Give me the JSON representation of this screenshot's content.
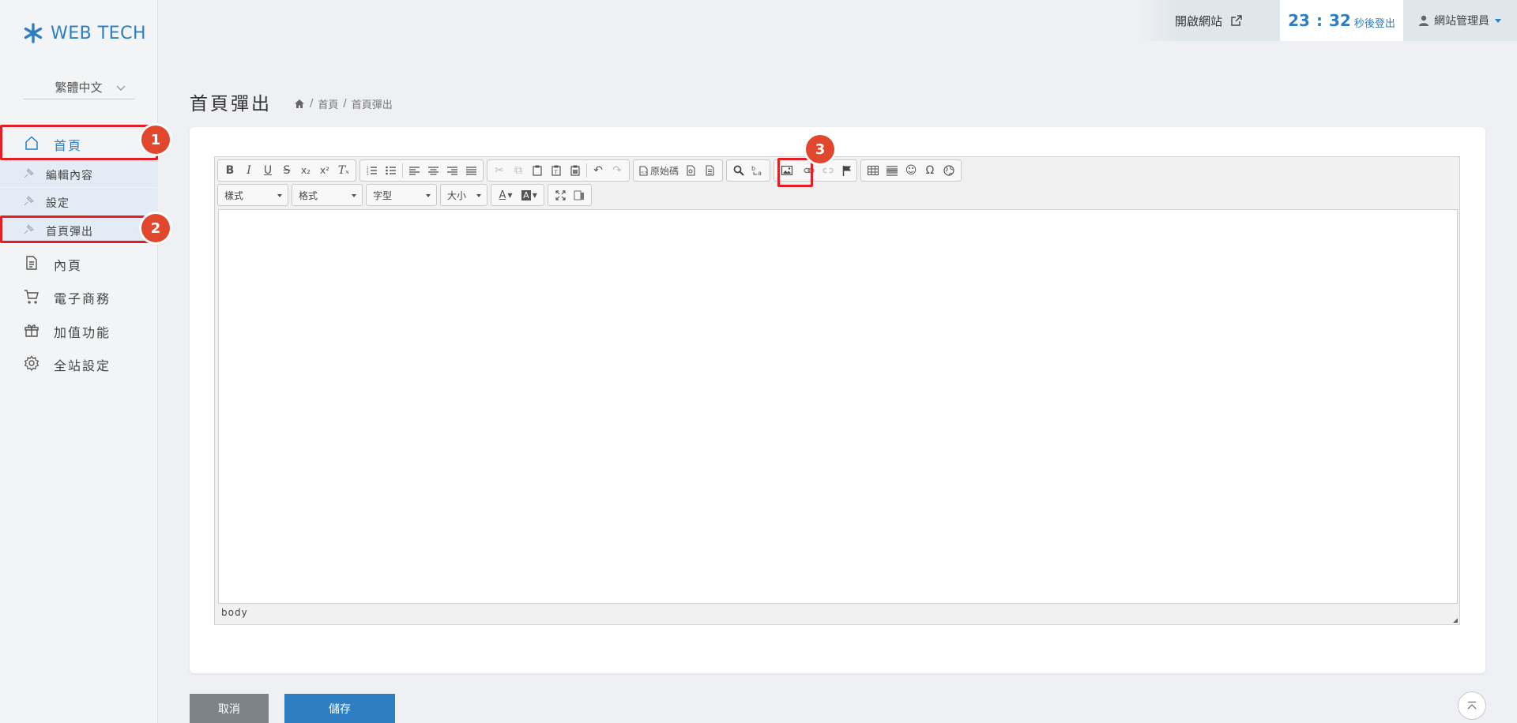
{
  "brand": {
    "name": "WEB TECH",
    "color": "#2e7fc1"
  },
  "language": {
    "selected": "繁體中文"
  },
  "sidebar": {
    "main": [
      {
        "label": "首頁",
        "icon": "home-icon"
      },
      {
        "label": "內頁",
        "icon": "document-icon"
      },
      {
        "label": "電子商務",
        "icon": "cart-icon"
      },
      {
        "label": "加值功能",
        "icon": "gift-icon"
      },
      {
        "label": "全站設定",
        "icon": "gear-icon"
      }
    ],
    "sub": [
      {
        "label": "編輯內容"
      },
      {
        "label": "設定"
      },
      {
        "label": "首頁彈出"
      }
    ]
  },
  "annotations": [
    "1",
    "2",
    "3"
  ],
  "topbar": {
    "open_site": "開啟網站",
    "timer_min": "23",
    "timer_sep": ":",
    "timer_sec": "32",
    "timer_text": "秒後登出",
    "user": "網站管理員"
  },
  "page": {
    "title": "首頁彈出",
    "breadcrumb": [
      "首頁",
      "首頁彈出"
    ],
    "breadcrumb_sep": "/"
  },
  "editor": {
    "source_label": "原始碼",
    "combos": [
      "樣式",
      "格式",
      "字型",
      "大小"
    ],
    "path": "body"
  },
  "buttons": {
    "cancel": "取消",
    "save": "儲存"
  },
  "colors": {
    "accent": "#2e7fc1",
    "highlight": "#e31e25",
    "badge": "#e0472c"
  }
}
